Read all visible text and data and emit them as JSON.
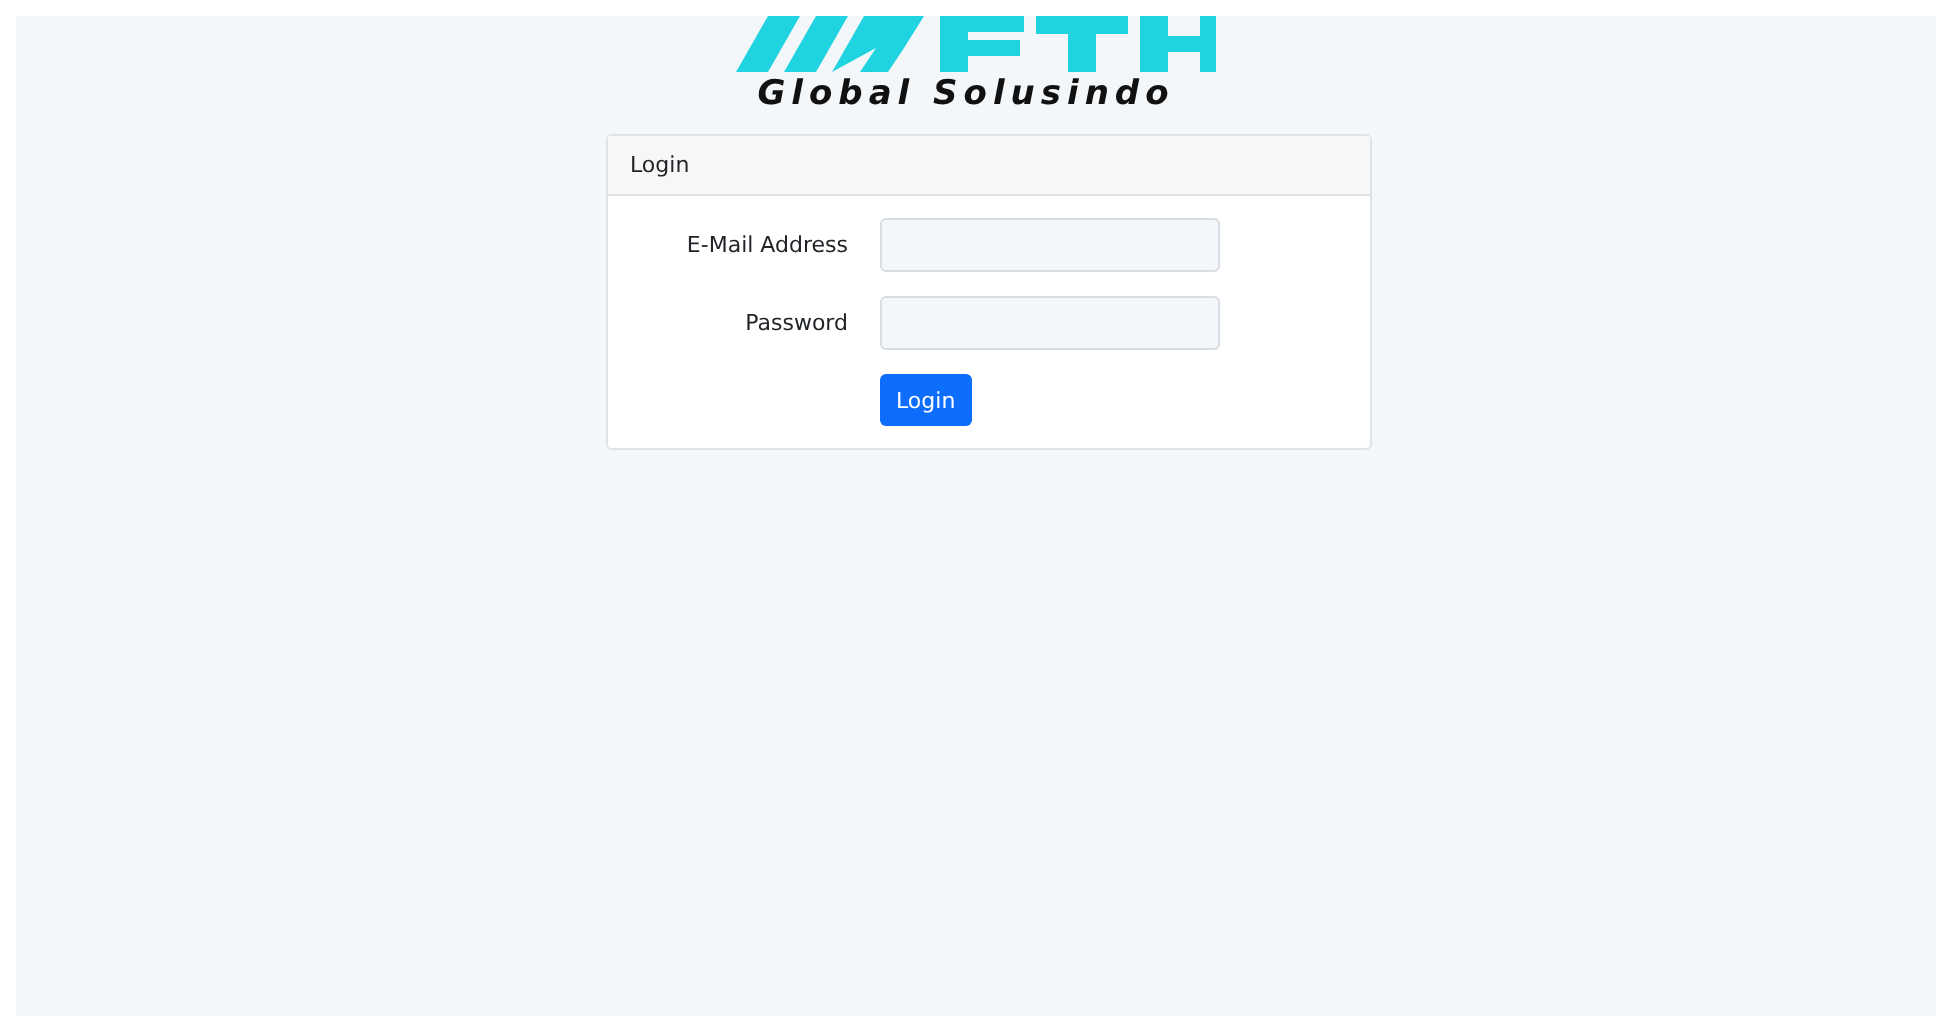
{
  "brand": {
    "tagline": "Global Solusindo"
  },
  "card": {
    "title": "Login",
    "fields": [
      {
        "label": "E-Mail Address"
      },
      {
        "label": "Password"
      }
    ],
    "button": "Login"
  }
}
